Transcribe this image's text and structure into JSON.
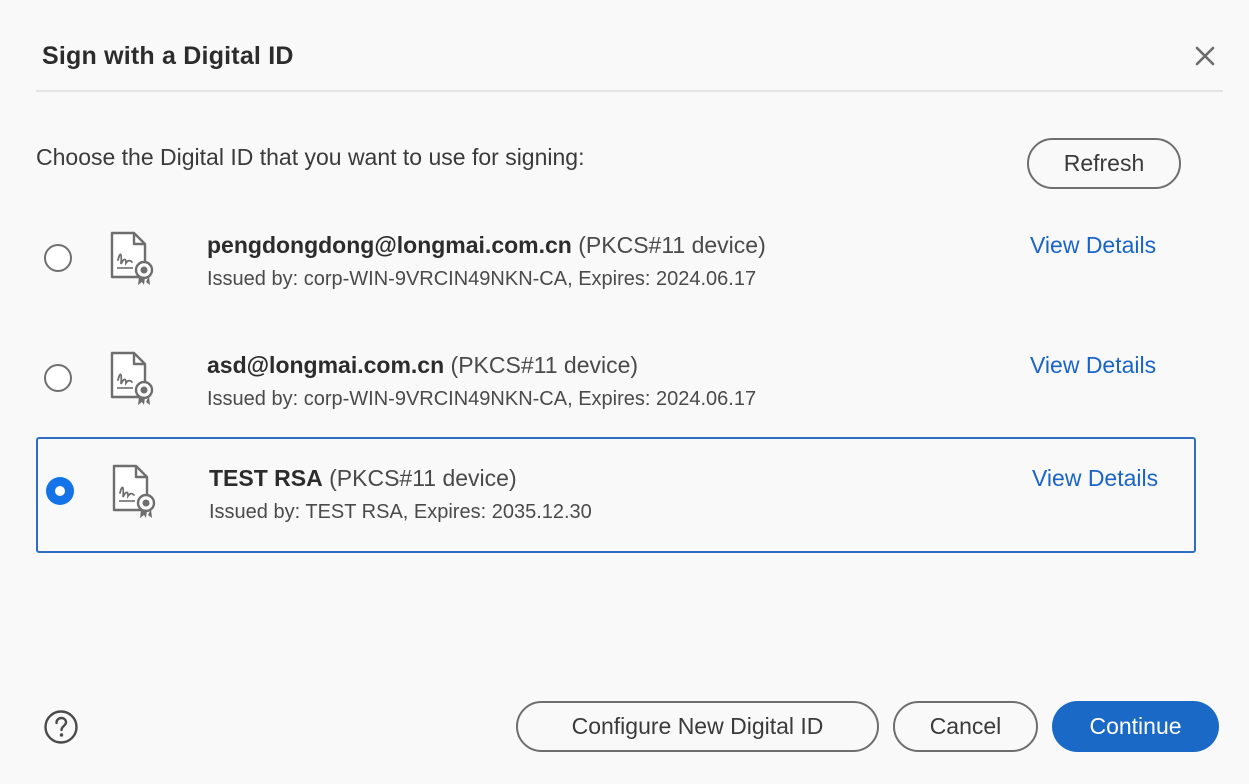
{
  "dialog": {
    "title": "Sign with a Digital ID",
    "close_icon": "close-icon"
  },
  "prompt": "Choose the Digital ID that you want to use for signing:",
  "refresh_label": "Refresh",
  "digital_ids": [
    {
      "name": "pengdongdong@longmai.com.cn",
      "device": "(PKCS#11 device)",
      "issued": "Issued by: corp-WIN-9VRCIN49NKN-CA, Expires: 2024.06.17",
      "view_details": "View Details",
      "selected": false,
      "icon": "certificate-icon"
    },
    {
      "name": "asd@longmai.com.cn",
      "device": "(PKCS#11 device)",
      "issued": "Issued by: corp-WIN-9VRCIN49NKN-CA, Expires: 2024.06.17",
      "view_details": "View Details",
      "selected": false,
      "icon": "certificate-icon"
    },
    {
      "name": "TEST RSA",
      "device": "(PKCS#11 device)",
      "issued": "Issued by: TEST RSA, Expires: 2035.12.30",
      "view_details": "View Details",
      "selected": true,
      "icon": "certificate-icon"
    }
  ],
  "footer": {
    "help_icon": "help-icon",
    "configure_label": "Configure New Digital ID",
    "cancel_label": "Cancel",
    "continue_label": "Continue"
  },
  "colors": {
    "accent": "#1a69c7",
    "link": "#1a64c8",
    "selected_border": "#2e6fc4",
    "background": "#f9f9f9"
  }
}
